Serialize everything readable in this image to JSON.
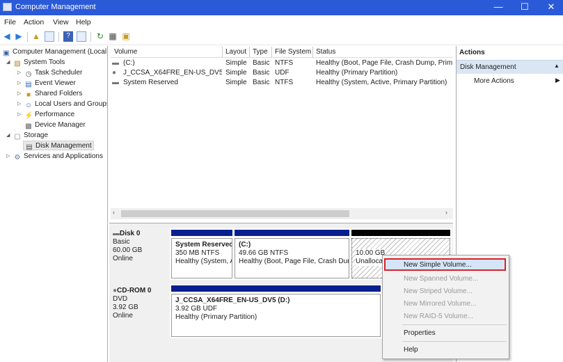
{
  "window": {
    "title": "Computer Management",
    "minimize_glyph": "—",
    "maximize_glyph": "☐",
    "close_glyph": "✕"
  },
  "menu": [
    "File",
    "Action",
    "View",
    "Help"
  ],
  "tree": {
    "root": "Computer Management (Local",
    "system_tools": "System Tools",
    "task_scheduler": "Task Scheduler",
    "event_viewer": "Event Viewer",
    "shared_folders": "Shared Folders",
    "local_users": "Local Users and Groups",
    "performance": "Performance",
    "device_manager": "Device Manager",
    "storage": "Storage",
    "disk_management": "Disk Management",
    "services": "Services and Applications"
  },
  "volume_list": {
    "columns": [
      "Volume",
      "Layout",
      "Type",
      "File System",
      "Status"
    ],
    "rows": [
      {
        "volume": "(C:)",
        "layout": "Simple",
        "type": "Basic",
        "fs": "NTFS",
        "status": "Healthy (Boot, Page File, Crash Dump, Primar"
      },
      {
        "volume": "J_CCSA_X64FRE_EN-US_DV5 (D:)",
        "layout": "Simple",
        "type": "Basic",
        "fs": "UDF",
        "status": "Healthy (Primary Partition)"
      },
      {
        "volume": "System Reserved",
        "layout": "Simple",
        "type": "Basic",
        "fs": "NTFS",
        "status": "Healthy (System, Active, Primary Partition)"
      }
    ]
  },
  "disk0": {
    "name": "Disk 0",
    "type": "Basic",
    "size": "60.00 GB",
    "state": "Online",
    "partitions": [
      {
        "name": "System Reservec",
        "size": "350 MB NTFS",
        "status": "Healthy (System, A"
      },
      {
        "name": "(C:)",
        "size": "49.66 GB NTFS",
        "status": "Healthy (Boot, Page File, Crash Dun"
      },
      {
        "size": "10.00 GB",
        "status": "Unallocat"
      }
    ]
  },
  "cdrom0": {
    "name": "CD-ROM 0",
    "type": "DVD",
    "size": "3.92 GB",
    "state": "Online",
    "partition": {
      "name": "J_CCSA_X64FRE_EN-US_DV5  (D:)",
      "size": "3.92 GB UDF",
      "status": "Healthy (Primary Partition)"
    }
  },
  "actions": {
    "header": "Actions",
    "section": "Disk Management",
    "more_actions": "More Actions"
  },
  "context_menu": {
    "new_simple": "New Simple Volume...",
    "new_spanned": "New Spanned Volume...",
    "new_striped": "New Striped Volume...",
    "new_mirrored": "New Mirrored Volume...",
    "new_raid5": "New RAID-5 Volume...",
    "properties": "Properties",
    "help": "Help"
  },
  "colors": {
    "titlebar": "#2b5ad8",
    "partition_bar_primary": "#0a1f8f",
    "partition_bar_unallocated": "#000000",
    "highlight_outline": "#d9212a"
  }
}
